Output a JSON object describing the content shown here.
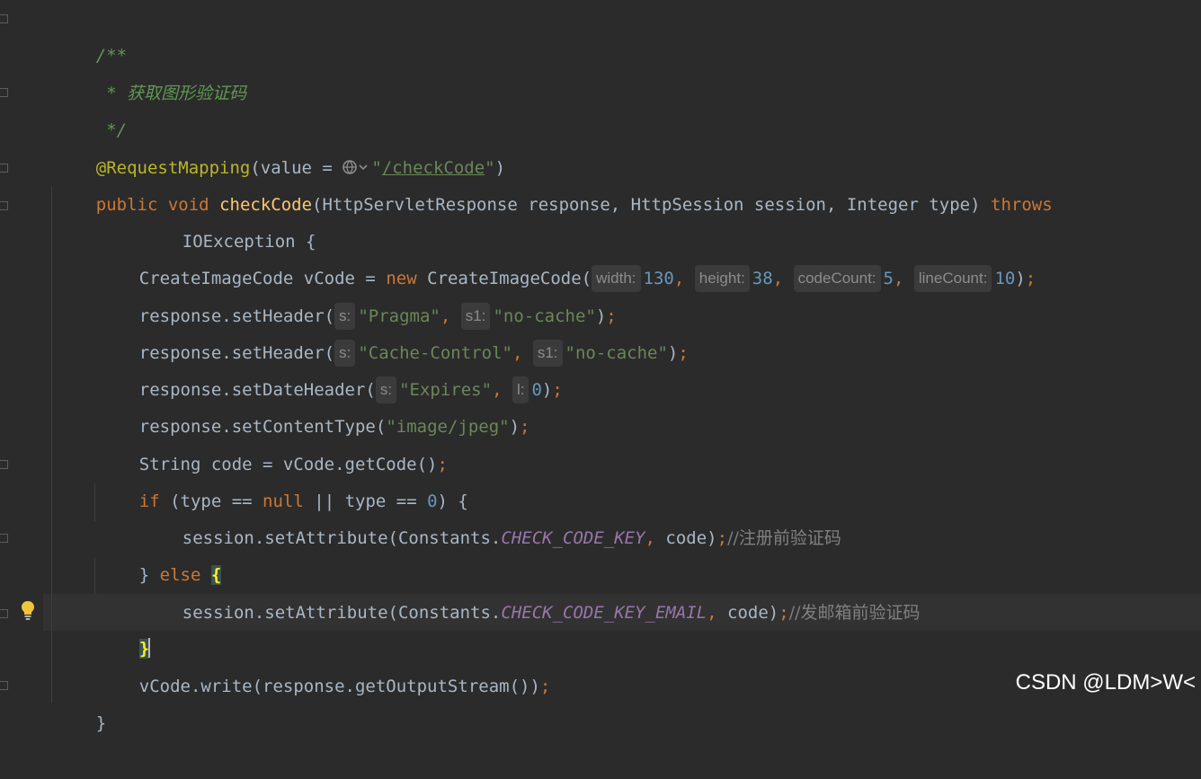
{
  "editor": {
    "theme_colors": {
      "background": "#2b2b2b",
      "keyword": "#cc7832",
      "method": "#ffc66d",
      "string": "#6a8759",
      "number": "#6897bb",
      "doc_comment": "#629755",
      "annotation": "#bbb529",
      "constant": "#9876aa"
    },
    "doc": {
      "open": "/**",
      "body": " * 获取图形验证码",
      "close": " */"
    },
    "annotation": {
      "name": "@RequestMapping",
      "open": "(value = ",
      "url": "/checkCode",
      "close": ")"
    },
    "signature": {
      "mod": "public",
      "ret": "void",
      "method": "checkCode",
      "params": "(HttpServletResponse response, HttpSession session, Integer type) ",
      "throws_kw": "throws",
      "exception": "IOException {"
    },
    "create_line": {
      "type": "CreateImageCode vCode = ",
      "new_kw": "new",
      "ctor": " CreateImageCode(",
      "hints": [
        "width:",
        "height:",
        "codeCount:",
        "lineCount:"
      ],
      "values": [
        "130",
        "38",
        "5",
        "10"
      ]
    },
    "header1": {
      "call": "response.setHeader(",
      "hint1": "s:",
      "arg1": "\"Pragma\"",
      "hint2": "s1:",
      "arg2": "\"no-cache\""
    },
    "header2": {
      "call": "response.setHeader(",
      "hint1": "s:",
      "arg1": "\"Cache-Control\"",
      "hint2": "s1:",
      "arg2": "\"no-cache\""
    },
    "date_header": {
      "call": "response.setDateHeader(",
      "hint1": "s:",
      "arg1": "\"Expires\"",
      "hint2": "l:",
      "arg2": "0"
    },
    "content_type": {
      "call": "response.setContentType(",
      "arg": "\"image/jpeg\""
    },
    "code_line": "String code = vCode.getCode()",
    "if_line": {
      "if_kw": "if",
      "mid1": " (type == ",
      "null_kw": "null",
      "mid2": " || type == ",
      "zero": "0",
      "end": ") {"
    },
    "set1": {
      "call": "session.setAttribute(Constants.",
      "const": "CHECK_CODE_KEY",
      "rest": " code)",
      "comment": "//注册前验证码"
    },
    "else_line": {
      "brace": "} ",
      "else_kw": "else",
      "open": "{"
    },
    "set2": {
      "call": "session.setAttribute(Constants.",
      "const": "CHECK_CODE_KEY_EMAIL",
      "rest": " code)",
      "comment": "//发邮箱前验证码"
    },
    "close_else": "}",
    "write_line": "vCode.write(response.getOutputStream())",
    "close_method": "}"
  },
  "icons": {
    "globe": "globe-icon",
    "bulb": "lightbulb-icon"
  },
  "watermark": "CSDN @LDM>W<"
}
